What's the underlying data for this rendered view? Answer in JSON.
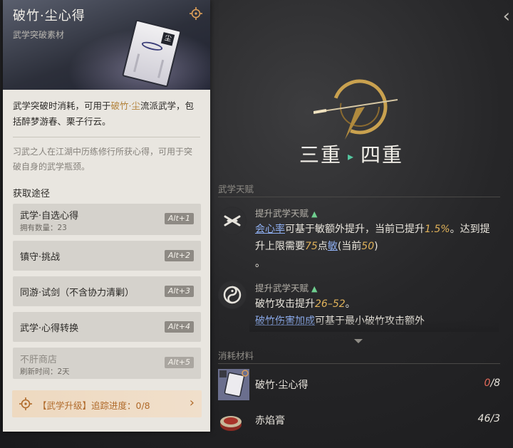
{
  "card": {
    "title": "破竹·尘心得",
    "type": "武学突破素材",
    "desc1_a": "武学突破时消耗，可用于",
    "desc1_hl": "破竹·尘",
    "desc1_b": "流派武学，包括醉梦游春、栗子行云。",
    "desc2": "习武之人在江湖中历练修行所获心得，可用于突破自身的武学瓶颈。",
    "sources_title": "获取途径",
    "sources": [
      {
        "label": "武学·自选心得",
        "sub": "拥有数量：23",
        "key": "Alt+1"
      },
      {
        "label": "镇守·挑战",
        "key": "Alt+2"
      },
      {
        "label": "同游·试剑（不含协力清剿）",
        "key": "Alt+3"
      },
      {
        "label": "武学·心得转换",
        "key": "Alt+4"
      },
      {
        "label": "不肝商店",
        "sub": "刷新时间：2天",
        "key": "Alt+5"
      }
    ],
    "track": {
      "text": "【武学升级】追踪进度：0/8",
      "chevron": "›"
    },
    "image_seal": "尘"
  },
  "stage": {
    "from": "三重",
    "arrow": "▸",
    "to": "四重"
  },
  "top_chevron": "‹",
  "talents": {
    "section": "武学天赋",
    "items": [
      {
        "head": "提升武学天赋",
        "up": "▲",
        "link": "会心率",
        "t1": "可基于敏额外提升，当前已提升",
        "num1": "1.5%",
        "t2": "。达到提升上限需要",
        "num2": "75",
        "t3": "点",
        "link2": "敏",
        "t4": "(当前",
        "num3": "50",
        "t5": ")",
        "t6": "。"
      },
      {
        "head": "提升武学天赋",
        "up": "▲",
        "t1": "破竹攻击提升",
        "num1": "26–52",
        "t2": "。",
        "link": "破竹伤害加成",
        "t3": "可基于最小破竹攻击额外"
      }
    ]
  },
  "materials": {
    "section": "消耗材料",
    "items": [
      {
        "name": "破竹·尘心得",
        "have": "0",
        "need": "/8"
      },
      {
        "name": "赤焰膏",
        "count": "46/3"
      }
    ]
  },
  "colors": {
    "accent_gold": "#b3833c",
    "link_blue": "#8eaef0",
    "up_green": "#6fcf8f",
    "insufficient_red": "#e46a5a"
  }
}
